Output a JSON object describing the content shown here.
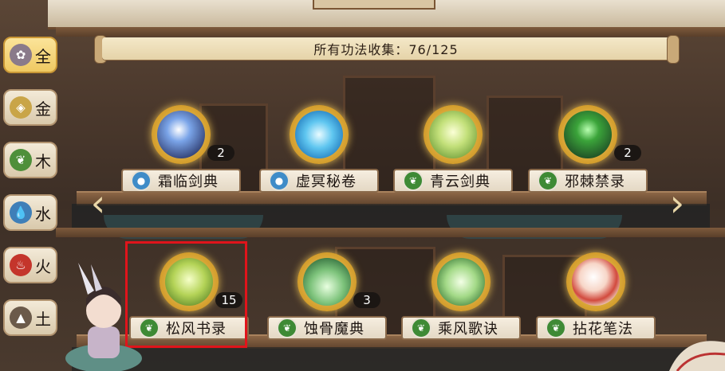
{
  "banner": {
    "text": "所有功法收集：76/125"
  },
  "tabs": [
    {
      "label": "全",
      "icon": "all-elements-icon",
      "color": "#8a7a8a",
      "active": true
    },
    {
      "label": "金",
      "icon": "metal-icon",
      "color": "#c9a548",
      "active": false
    },
    {
      "label": "木",
      "icon": "wood-icon",
      "color": "#4e8f3a",
      "active": false
    },
    {
      "label": "水",
      "icon": "water-icon",
      "color": "#3f7fb8",
      "active": false
    },
    {
      "label": "火",
      "icon": "fire-icon",
      "color": "#c4352b",
      "active": false
    },
    {
      "label": "土",
      "icon": "earth-icon",
      "color": "#6b5a4a",
      "active": false
    }
  ],
  "items": [
    {
      "name": "霜临剑典",
      "count": "2",
      "element": "water",
      "art": "frost-sword-art"
    },
    {
      "name": "虚冥秘卷",
      "count": "",
      "element": "water",
      "art": "void-scroll-art"
    },
    {
      "name": "青云剑典",
      "count": "",
      "element": "wood",
      "art": "azure-cloud-sword-art"
    },
    {
      "name": "邪棘禁录",
      "count": "2",
      "element": "wood",
      "art": "evil-thorn-art"
    },
    {
      "name": "松风书录",
      "count": "15",
      "element": "wood",
      "art": "pine-wind-art"
    },
    {
      "name": "蚀骨魔典",
      "count": "3",
      "element": "wood",
      "art": "bone-eroding-art"
    },
    {
      "name": "乘风歌诀",
      "count": "",
      "element": "wood",
      "art": "wind-riding-art"
    },
    {
      "name": "拈花笔法",
      "count": "",
      "element": "wood",
      "art": "flower-brush-art"
    }
  ],
  "colors": {
    "water": "#3f8cc8",
    "wood": "#3e8a35",
    "selection": "#e0141b"
  }
}
